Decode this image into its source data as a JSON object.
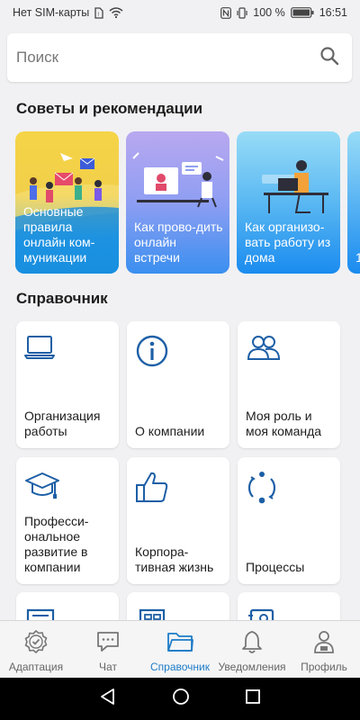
{
  "status_bar": {
    "carrier": "Нет SIM-карты",
    "battery": "100 %",
    "time": "16:51"
  },
  "search": {
    "placeholder": "Поиск",
    "icon": "search-icon"
  },
  "tips": {
    "title": "Советы и рекомендации",
    "cards": [
      {
        "label": "Основные правила онлайн ком-муникации",
        "color_top": "#f3d34a",
        "color_bottom": "#1b9ae6"
      },
      {
        "label": "Как прово-дить онлайн встречи",
        "color_top": "#b7a6f0",
        "color_bottom": "#3a8ff0"
      },
      {
        "label": "Как организо-вать работу из дома",
        "color_top": "#8fd8f6",
        "color_bottom": "#1c8ef0"
      },
      {
        "label": "1",
        "color_top": "#8fd8f6",
        "color_bottom": "#1c8ef0"
      }
    ]
  },
  "reference": {
    "title": "Справочник",
    "tiles": [
      {
        "label": "Организация работы",
        "icon": "laptop-icon"
      },
      {
        "label": "О компании",
        "icon": "info-icon"
      },
      {
        "label": "Моя роль и моя команда",
        "icon": "team-icon"
      },
      {
        "label": "Професси-ональное развитие в компании",
        "icon": "graduation-cap-icon"
      },
      {
        "label": "Корпора-тивная жизнь",
        "icon": "thumbs-up-icon"
      },
      {
        "label": "Процессы",
        "icon": "cycle-icon"
      }
    ]
  },
  "bottom_nav": {
    "active_color": "#1e7cc7",
    "items": [
      {
        "label": "Адаптация",
        "icon": "badge-check-icon"
      },
      {
        "label": "Чат",
        "icon": "chat-icon"
      },
      {
        "label": "Справочник",
        "icon": "folder-icon"
      },
      {
        "label": "Уведомления",
        "icon": "bell-icon"
      },
      {
        "label": "Профиль",
        "icon": "profile-icon"
      }
    ]
  }
}
